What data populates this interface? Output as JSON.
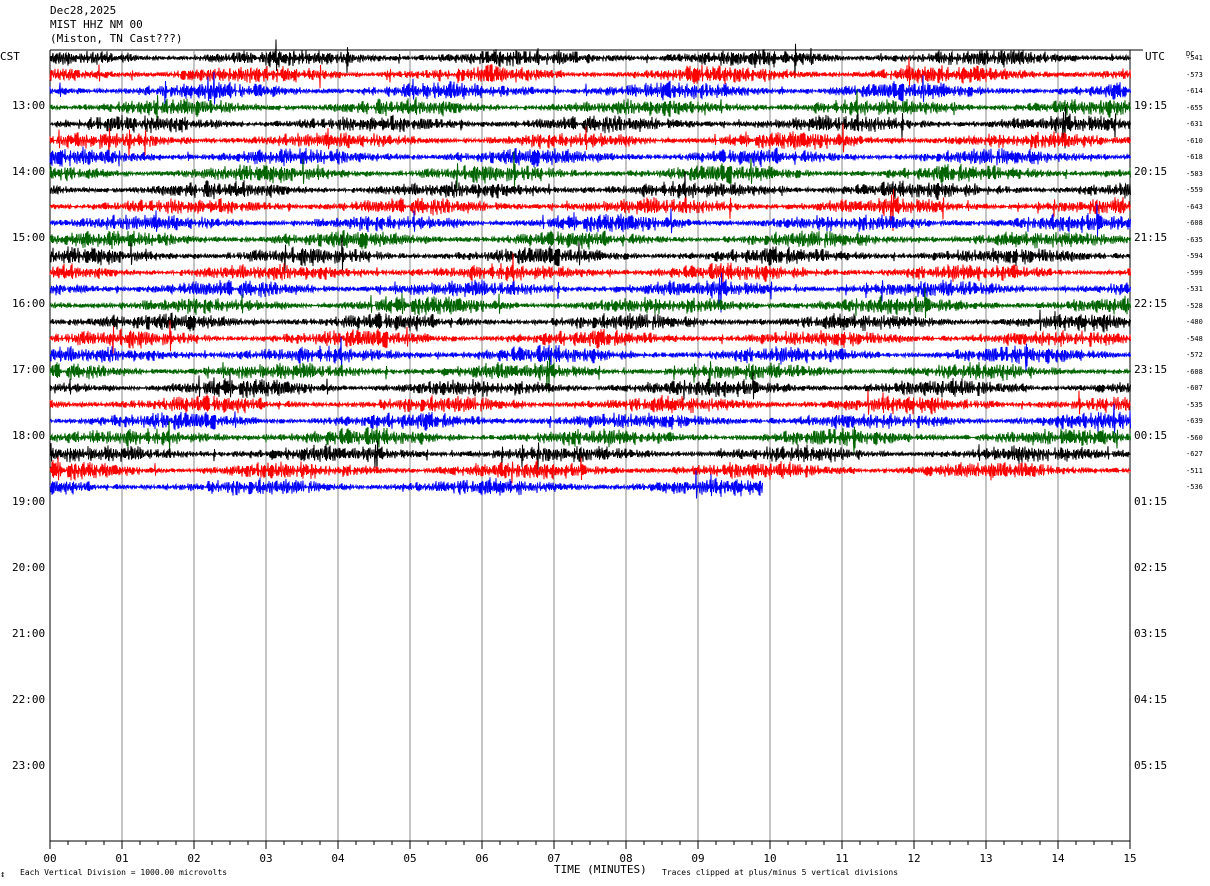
{
  "header": {
    "date": "Dec28,2025",
    "station": "MIST HHZ NM 00",
    "location": "(Miston, TN Cast???)"
  },
  "timezones": {
    "left": "CST",
    "right": "UTC",
    "dc": "DC"
  },
  "hour_labels_left": [
    "13:00",
    "14:00",
    "15:00",
    "16:00",
    "17:00",
    "18:00",
    "19:00",
    "20:00",
    "21:00",
    "22:00",
    "23:00"
  ],
  "hour_labels_right": [
    "19:15",
    "20:15",
    "21:15",
    "22:15",
    "23:15",
    "00:15",
    "01:15",
    "02:15",
    "03:15",
    "04:15",
    "05:15"
  ],
  "dc_offsets": [
    "-541",
    "-573",
    "-614",
    "-655",
    "-631",
    "-610",
    "-618",
    "-583",
    "-559",
    "-643",
    "-608",
    "-635",
    "-594",
    "-599",
    "-531",
    "-528",
    "-480",
    "-548",
    "-572",
    "-608",
    "-607",
    "-535",
    "-639",
    "-560",
    "-627",
    "-511",
    "-536"
  ],
  "x_ticks": [
    "00",
    "01",
    "02",
    "03",
    "04",
    "05",
    "06",
    "07",
    "08",
    "09",
    "10",
    "11",
    "12",
    "13",
    "14",
    "15"
  ],
  "footer": {
    "logo": "↕",
    "scale": "Each Vertical Division = 1000.00 microvolts",
    "xlabel": "TIME (MINUTES)",
    "clip": "Traces clipped at plus/minus 5 vertical divisions"
  },
  "chart_data": {
    "type": "line",
    "title": "MIST HHZ NM 00",
    "xlabel": "TIME (MINUTES)",
    "xlim": [
      0,
      15
    ],
    "trace_interval_minutes": 15,
    "traces_per_hour": 4,
    "first_trace_hour_cst": 12.25,
    "trace_colors": [
      "#000000",
      "#ff0000",
      "#0000ff",
      "#006400"
    ],
    "trace_count": 27,
    "last_trace_end_minute": 9.9,
    "grid": true,
    "clip_divisions": 5
  }
}
